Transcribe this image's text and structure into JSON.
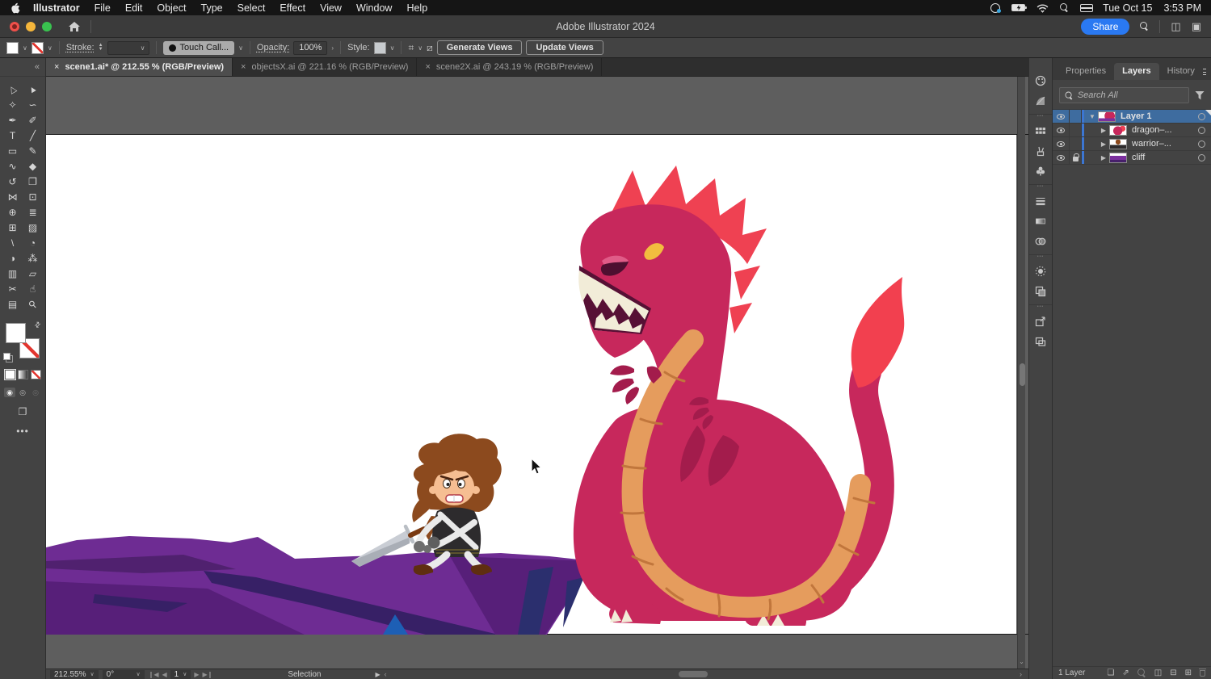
{
  "window": {
    "title": "Adobe Illustrator 2024",
    "share_label": "Share",
    "clock_date": "Tue Oct 15",
    "clock_time": "3:53 PM"
  },
  "menu": {
    "app": "Illustrator",
    "items": [
      "File",
      "Edit",
      "Object",
      "Type",
      "Select",
      "Effect",
      "View",
      "Window",
      "Help"
    ]
  },
  "options_bar": {
    "stroke_label": "Stroke:",
    "brush_name": "Touch Call...",
    "opacity_label": "Opacity:",
    "opacity_value": "100%",
    "style_label": "Style:",
    "generate_label": "Generate Views",
    "update_label": "Update Views"
  },
  "document_tabs": [
    {
      "label": "scene1.ai* @ 212.55 % (RGB/Preview)",
      "active": true
    },
    {
      "label": "objectsX.ai @ 221.16 % (RGB/Preview)",
      "active": false
    },
    {
      "label": "scene2X.ai @ 243.19 % (RGB/Preview)",
      "active": false
    }
  ],
  "toolbar": {
    "collapse_glyph": "«",
    "tools": [
      {
        "name": "selection",
        "glyph": "△",
        "cls": "rot"
      },
      {
        "name": "direct-selection",
        "glyph": "▲",
        "cls": "rot"
      },
      {
        "name": "magic-wand",
        "glyph": "✧"
      },
      {
        "name": "lasso",
        "glyph": "∽"
      },
      {
        "name": "pen",
        "glyph": "✒"
      },
      {
        "name": "curvature",
        "glyph": "✐"
      },
      {
        "name": "type",
        "glyph": "T"
      },
      {
        "name": "line-segment",
        "glyph": "╱"
      },
      {
        "name": "rectangle",
        "glyph": "▭"
      },
      {
        "name": "paintbrush",
        "glyph": "✎"
      },
      {
        "name": "shaper",
        "glyph": "∿"
      },
      {
        "name": "eraser",
        "glyph": "◆"
      },
      {
        "name": "rotate",
        "glyph": "↺"
      },
      {
        "name": "scale",
        "glyph": "❐"
      },
      {
        "name": "width",
        "glyph": "⋈"
      },
      {
        "name": "free-transform",
        "glyph": "⊡"
      },
      {
        "name": "shape-builder",
        "glyph": "⊕"
      },
      {
        "name": "perspective-grid",
        "glyph": "≣"
      },
      {
        "name": "mesh",
        "glyph": "⊞"
      },
      {
        "name": "gradient",
        "glyph": "▨"
      },
      {
        "name": "eyedropper",
        "glyph": "\\"
      },
      {
        "name": "measure",
        "glyph": "◔"
      },
      {
        "name": "blend",
        "glyph": "◑"
      },
      {
        "name": "symbol-sprayer",
        "glyph": "⁂"
      },
      {
        "name": "column-graph",
        "glyph": "▥"
      },
      {
        "name": "artboard",
        "glyph": "▱"
      },
      {
        "name": "slice",
        "glyph": "✂"
      },
      {
        "name": "hand",
        "glyph": "☝"
      },
      {
        "name": "print-tiling",
        "glyph": "▤"
      },
      {
        "name": "zoom",
        "glyph": "⚲",
        "cls": "rotm"
      }
    ]
  },
  "dock": {
    "icons": [
      "color",
      "color-guide",
      "swatches",
      "brushes",
      "symbols",
      "stroke",
      "gradient",
      "transparency",
      "appearance",
      "graphic-styles",
      "export",
      "artboards"
    ],
    "dividers_before": [
      2,
      5,
      8,
      10
    ]
  },
  "layers_panel": {
    "tabs": [
      {
        "label": "Properties",
        "active": false
      },
      {
        "label": "Layers",
        "active": true
      },
      {
        "label": "History",
        "active": false
      }
    ],
    "search_placeholder": "Search All",
    "layers": [
      {
        "name": "Layer 1",
        "selected": true,
        "expanded": true,
        "visible": true,
        "locked": false,
        "child": false,
        "thumb": "scene"
      },
      {
        "name": "dragon–...",
        "selected": false,
        "expanded": false,
        "visible": true,
        "locked": false,
        "child": true,
        "thumb": "dragon"
      },
      {
        "name": "warrior–...",
        "selected": false,
        "expanded": false,
        "visible": true,
        "locked": false,
        "child": true,
        "thumb": "warrior"
      },
      {
        "name": "cliff",
        "selected": false,
        "expanded": false,
        "visible": true,
        "locked": true,
        "child": true,
        "thumb": "cliff"
      }
    ],
    "footer_count": "1 Layer"
  },
  "status_bar": {
    "zoom": "212.55%",
    "rotation": "0°",
    "artboard_number": "1",
    "mode_label": "Selection"
  },
  "artwork": {
    "description": "Red cartoon dragon with orange striped belly facing a small angry warrior holding a sword on a purple rocky cliff",
    "colors": {
      "accent": "#2A79F2",
      "sel_row": "#3E6C9F",
      "layer_accent": "#3C76D2",
      "dragon_body": "#C7285C",
      "dragon_dark": "#A31C4C",
      "dragon_crest": "#EF4152",
      "flame": "#F2404F",
      "dragon_eye": "#F2BD3F",
      "dragon_mouth": "#571035",
      "teeth": "#F2ECD8",
      "dragon_belly": "#E59C5D",
      "belly_stripe": "#C1763C",
      "brow_pink": "#E05C88",
      "hair": "#8C4A1E",
      "skin": "#F6BE92",
      "tunic": "#2D2B2D",
      "limb": "#EAEAEA",
      "glove": "#6E6E6E",
      "blade": "#C9CDD4",
      "grip": "#7A3A12",
      "boot": "#5F2E10",
      "cliff_main": "#6E2C93",
      "cliff_dark": "#571F79",
      "cliff_dark2": "#50216F",
      "cliff_crack": "#372066",
      "cliff_navy": "#2B2F6E",
      "cliff_blue": "#1D5FB5"
    }
  }
}
